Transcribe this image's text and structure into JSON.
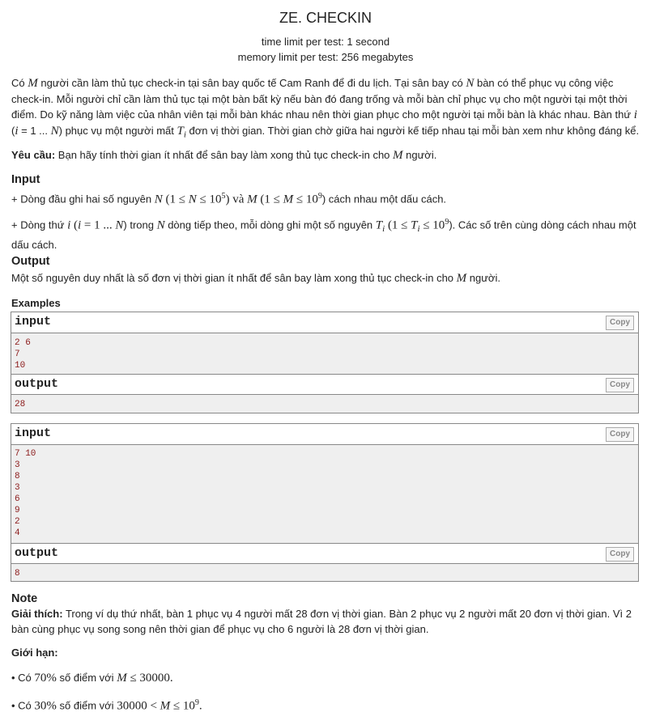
{
  "problem": {
    "title": "ZE. CHECKIN",
    "time_limit": "time limit per test: 1 second",
    "memory_limit": "memory limit per test: 256 megabytes"
  },
  "statement": {
    "p1_a": "Có ",
    "p1_M": "M",
    "p1_b": " người cần làm thủ tục check-in tại sân bay quốc tế Cam Ranh để đi du lịch. Tại sân bay có ",
    "p1_N": "N",
    "p1_c": " bàn có thể phục vụ công việc check-in. Mỗi người chỉ cần làm thủ tục tại một bàn bất kỳ nếu bàn đó đang trống và mỗi bàn chỉ phục vụ cho một người tại một thời điểm. Do kỹ năng làm việc của nhân viên tại mỗi bàn khác nhau nên thời gian phục cho một người tại mỗi bàn là khác nhau. Bàn thứ ",
    "p1_i": "i",
    "p1_d": " (",
    "p1_i2": "i",
    "p1_e": " = 1 ... ",
    "p1_N2": "N",
    "p1_f": ") phục vụ một người mất ",
    "p1_T": "T",
    "p1_Ti": "i",
    "p1_g": " đơn vị thời gian. Thời gian chờ giữa hai người kế tiếp nhau tại mỗi bàn xem như không đáng kể.",
    "req_label": "Yêu cầu:",
    "req_text": " Bạn hãy tính thời gian ít nhất để sân bay làm xong thủ tục check-in cho ",
    "req_M": "M",
    "req_end": " người."
  },
  "input_section": {
    "heading": "Input",
    "l1_a": "+ Dòng đầu ghi hai số nguyên ",
    "l1_N": "N",
    "l1_b": " (1 ≤ ",
    "l1_N2": "N",
    "l1_c": " ≤ 10",
    "l1_exp1": "5",
    "l1_d": ") và ",
    "l1_M": "M",
    "l1_e": " (1 ≤ ",
    "l1_M2": "M",
    "l1_f": " ≤ 10",
    "l1_exp2": "9",
    "l1_g": ") cách nhau một dấu cách.",
    "l2_a": "+ Dòng thứ ",
    "l2_i": "i",
    "l2_b": " (",
    "l2_i2": "i",
    "l2_c": " = 1 ... ",
    "l2_N": "N",
    "l2_d": ") trong ",
    "l2_N2": "N",
    "l2_e": " dòng tiếp theo, mỗi dòng ghi một số nguyên ",
    "l2_T": "T",
    "l2_Ti": "i",
    "l2_f": " (1 ≤ ",
    "l2_T2": "T",
    "l2_Ti2": "i",
    "l2_g": " ≤ 10",
    "l2_exp": "9",
    "l2_h": "). Các số trên cùng dòng cách nhau một dấu cách."
  },
  "output_section": {
    "heading": "Output",
    "text_a": "Một số nguyên duy nhất là số đơn vị thời gian ít nhất để sân bay làm xong thủ tục check-in cho ",
    "text_M": "M",
    "text_b": " người."
  },
  "examples": {
    "heading": "Examples",
    "input_label": "input",
    "output_label": "output",
    "copy_label": "Copy",
    "ex1_input": "2 6\n7\n10",
    "ex1_output": "28",
    "ex2_input": "7 10\n3\n8\n3\n6\n9\n2\n4",
    "ex2_output": "8"
  },
  "note": {
    "heading": "Note",
    "expl_label": "Giải thích:",
    "expl_text": " Trong ví dụ thứ nhất, bàn 1 phục vụ 4 người mất 28 đơn vị thời gian. Bàn 2 phục vụ 2 người mất 20 đơn vị thời gian. Vì 2 bàn cùng phục vụ song song nên thời gian để phục vụ cho 6 người là 28 đơn vị thời gian.",
    "limits_label": "Giới hạn:",
    "lim1_a": "• Có ",
    "lim1_pct": "70%",
    "lim1_b": " số điểm với ",
    "lim1_M": "M",
    "lim1_c": " ≤ 30000.",
    "lim2_a": "• Có ",
    "lim2_pct": "30%",
    "lim2_b": " số điểm với ",
    "lim2_n": "30000",
    "lim2_c": " < ",
    "lim2_M": "M",
    "lim2_d": " ≤ 10",
    "lim2_exp": "9",
    "lim2_e": "."
  }
}
